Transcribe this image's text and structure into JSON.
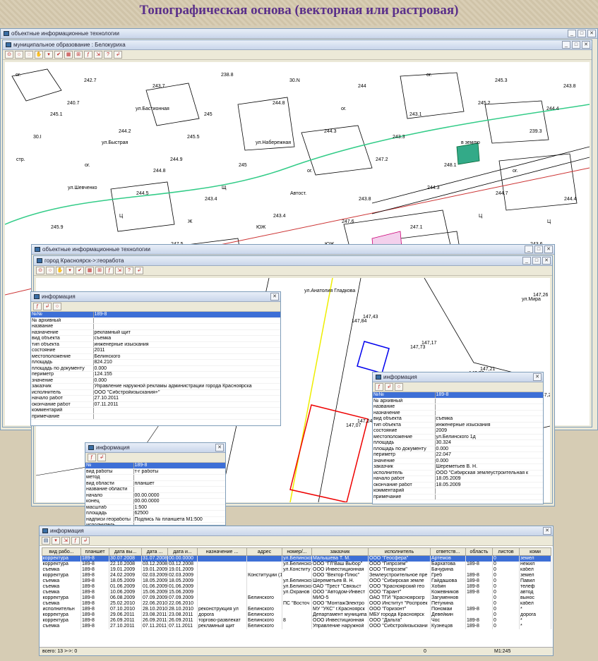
{
  "banner": {
    "title": "Топографическая основа (векторная или растровая)"
  },
  "app": {
    "title": "объектные информационные технологии"
  },
  "doc1": {
    "title": "муниципальное образование : Белокурихa"
  },
  "app2": {
    "title": "объектные информационные технологии"
  },
  "doc2": {
    "title": "город Красноярск->:георабота"
  },
  "map_labels": [
    "ог.",
    "242.7",
    "243.7",
    "238.8",
    "30.N",
    "244",
    "ог.",
    "245.3",
    "243.8",
    "240.7",
    "ул.Бастионная",
    "245",
    "244.8",
    "ог.",
    "243.1",
    "245.2",
    "244.4",
    "245.1",
    "244.2",
    "245.5",
    "ул.Набережная",
    "244.3",
    "243.3",
    "в землю",
    "239.3",
    "30.I",
    "ул.Быстрая",
    "244.9",
    "245",
    "ог.",
    "247.2",
    "248.1",
    "ог.",
    "стр.",
    "ог.",
    "244.8",
    "Щ",
    "Автост.",
    "243.8",
    "244.3",
    "244.7",
    "244.4",
    "ул.Шевченко",
    "244.5",
    "243.4",
    "243.4",
    "247.6",
    "247.1",
    "Ц",
    "Ц",
    "245.9",
    "Ц",
    "Ж",
    "ЮЖ",
    "ЮЖ",
    "244.9",
    "243.9",
    "243.6",
    "242.2",
    "242.4",
    "247.5",
    "244.9",
    "244.2",
    "247.0",
    "215.8",
    "6 вл. ш.",
    "ул.Анатолия Гладкова",
    "147,43",
    "147,17",
    "147,21",
    "147,28",
    "147,24",
    "147,09",
    "147,8",
    "147,26",
    "147,84",
    "147,73",
    "147,77",
    "147,16",
    "147,07",
    "147,06",
    "ул.Каштановая",
    "ул.Мира"
  ],
  "info1": {
    "title": "информация",
    "rows": [
      [
        "№№",
        "189-8"
      ],
      [
        "№ архивный",
        ""
      ],
      [
        "название",
        ""
      ],
      [
        "назначение",
        "рекламный щит"
      ],
      [
        "вид объекта",
        "съемка"
      ],
      [
        "тип объекта",
        "инженерные изыскания"
      ],
      [
        "состояние",
        "2011"
      ],
      [
        "местоположение",
        "Белинского"
      ],
      [
        "площадь",
        "824.210"
      ],
      [
        "площадь по документу",
        "0.000"
      ],
      [
        "периметр",
        "124.155"
      ],
      [
        "значение",
        "0.000"
      ],
      [
        "заказчик",
        "Управление наружной рекламы администрации города Красноярска"
      ],
      [
        "исполнитель",
        "ООО \"Сибстройизыскания+\""
      ],
      [
        "начало работ",
        "27.10.2011"
      ],
      [
        "окончание работ",
        "07.11.2011"
      ],
      [
        "комментарий",
        ""
      ],
      [
        "примечание",
        ""
      ]
    ]
  },
  "info2": {
    "title": "информация",
    "rows": [
      [
        "№№",
        "189-8"
      ],
      [
        "№ архивный",
        ""
      ],
      [
        "название",
        ""
      ],
      [
        "назначение",
        ""
      ],
      [
        "вид объекта",
        "съемка"
      ],
      [
        "тип объекта",
        "инженерные изыскания"
      ],
      [
        "состояние",
        "2009"
      ],
      [
        "местоположение",
        "ул.Белинского 1д"
      ],
      [
        "площадь",
        "30.324"
      ],
      [
        "площадь по документу",
        "0.000"
      ],
      [
        "периметр",
        "22.047"
      ],
      [
        "значение",
        "0.000"
      ],
      [
        "заказчик",
        "Шереметьев В. Н."
      ],
      [
        "исполнитель",
        "ООО \"Сибирская землеустроительная к"
      ],
      [
        "начало работ",
        "18.05.2009"
      ],
      [
        "окончание работ",
        "18.05.2009"
      ],
      [
        "комментарий",
        ""
      ],
      [
        "примечание",
        ""
      ]
    ]
  },
  "info3": {
    "title": "информация",
    "rows": [
      [
        "№",
        "189-8"
      ],
      [
        "вид работы",
        "т-г работы"
      ],
      [
        "метод",
        ""
      ],
      [
        "вид области",
        "планшет"
      ],
      [
        "название области",
        ""
      ],
      [
        "начало",
        "00.00.0000"
      ],
      [
        "конец",
        "00.00.0000"
      ],
      [
        "масштаб",
        "1:500"
      ],
      [
        "площадь",
        "62500"
      ],
      [
        "надписи геоработы",
        "Подпись № планшета М1:500"
      ],
      [
        "исполнитель",
        ""
      ]
    ]
  },
  "table": {
    "title": "информация",
    "headers": [
      "вид рабо...",
      "планшет",
      "дата вы...",
      "дата ...",
      "дата и...",
      "назначение ...",
      "адрес",
      "номер/...",
      "заказчик",
      "исполнитель",
      "ответств...",
      "область",
      "листов",
      "коми"
    ],
    "rows": [
      [
        "корректура",
        "189-8",
        "30.07.2008",
        "31.07.2008",
        "00.00.0000",
        "",
        "",
        "ул.Белинско",
        "Малышева Т. М.",
        "ООО \"Геосфера\"",
        "Артемов",
        "",
        "0",
        "земел"
      ],
      [
        "корректура",
        "189-8",
        "22.10.2008",
        "03.12.2008",
        "03.12.2008",
        "",
        "",
        "ул.Белинско",
        "ООО \"ГЛ'Ваш Выбор\"",
        "ООО \"Гипрозем\"",
        "Бархатова",
        "189-8",
        "0",
        "нежил"
      ],
      [
        "съемка",
        "189-8",
        "19.01.2009",
        "19.01.2009",
        "19.01.2009",
        "",
        "",
        "ул.Конститу",
        "ООО Инвестиционная",
        "ООО \"Гипрозем\"",
        "Бачурина",
        "",
        "0",
        "кабел"
      ],
      [
        "корректура",
        "189-8",
        "24.02.2009",
        "02.03.2009",
        "02.03.2009",
        "",
        "Конституции (1",
        "",
        "ООО \"Вектор-Плюс\"",
        "Землеустроительное пре",
        "Греб",
        "189-8",
        "0",
        "земел"
      ],
      [
        "съемка",
        "189-8",
        "18.05.2009",
        "18.05.2009",
        "18.05.2009",
        "",
        "",
        "ул.Белинско",
        "Шереметьев В. Н.",
        "ООО \"Сибирская земле",
        "Гайдашова",
        "189-8",
        "0",
        "Павил"
      ],
      [
        "съемка",
        "189-8",
        "01.06.2009",
        "01.06.2009",
        "01.06.2009",
        "",
        "",
        "ул.Белинско",
        "ОАО \"Трест \"Связьст",
        "ООО \"Красноярский гео",
        "Хобин",
        "189-8",
        "0",
        "телеф"
      ],
      [
        "съемка",
        "189-8",
        "10.06.2009",
        "15.06.2009",
        "15.06.2009",
        "",
        "",
        "ул.Охранов",
        "ООО \"Автодом-Инвест",
        "ООО \"Гарант\"",
        "Кожевников",
        "189-8",
        "0",
        "автод"
      ],
      [
        "корректура",
        "189-8",
        "06.08.2009",
        "07.09.2009",
        "07.09.2009",
        "",
        "Белинского",
        "",
        "МИО-5",
        "ОАО ТГИ \"Красноярскгр",
        "Загуменнов",
        "",
        "0",
        "вынос"
      ],
      [
        "съемка",
        "189-8",
        "25.02.2010",
        "22.06.2010",
        "22.06.2010",
        "",
        "",
        "ПС \"Восточ",
        "ООО \"МонтажЭлектро",
        "ООО Институт \"Роспроек",
        "Петунина",
        "",
        "0",
        "кабел"
      ],
      [
        "исполнительн",
        "189-8",
        "07.10.2010",
        "28.10.2010",
        "28.10.2010",
        "реконструкция ул",
        "Белинского",
        "",
        "МУ \"УКС\" г.Красноярск",
        "ООО \"Горизонт\"",
        "Пономаи",
        "189-8",
        "0",
        "*"
      ],
      [
        "корректура",
        "189-8",
        "29.06.2011",
        "23.08.2011",
        "23.08.2011",
        "дорога",
        "Белинского",
        "",
        "Департамент муниципа",
        "МБУ города Красноярск",
        "Девейкин",
        "",
        "0",
        "дорога"
      ],
      [
        "корректура",
        "189-8",
        "26.09.2011",
        "26.09.2011",
        "26.09.2011",
        "торгово-развлекат",
        "Белинского",
        "8",
        "ООО Инвестиционная",
        "ООО \"Дальта\"",
        "Чос",
        "189-8",
        "0",
        "*"
      ],
      [
        "съемка",
        "189-8",
        "27.10.2011",
        "07.11.2011",
        "07.11.2011",
        "рекламный щит",
        "Белинского",
        "",
        "Управление наружной",
        "ООО \"Сибстройизыскани",
        "Кузнецов",
        "189-8",
        "0",
        "*"
      ]
    ],
    "footer": "всего: 13 >->: 0",
    "status": "0",
    "scale": "M1:245"
  }
}
